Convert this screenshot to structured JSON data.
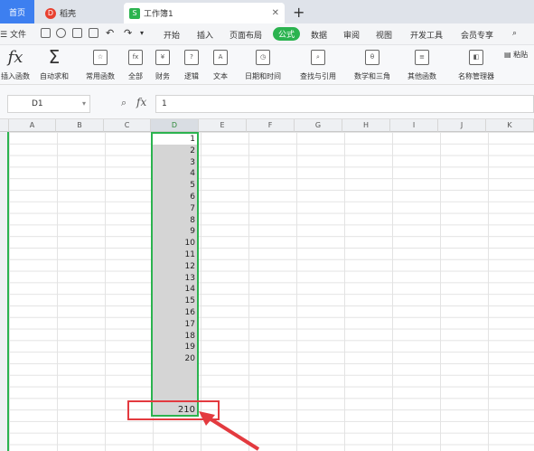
{
  "tabs": {
    "home": "首页",
    "daoke": "稻壳",
    "workbook": "工作簿1"
  },
  "menu": {
    "file": "文件",
    "items": [
      "开始",
      "插入",
      "页面布局",
      "公式",
      "数据",
      "审阅",
      "视图",
      "开发工具",
      "会员专享"
    ],
    "active": "公式"
  },
  "ribbon": {
    "insert_function": "插入函数",
    "autosum": "自动求和",
    "common_functions": "常用函数",
    "all": "全部",
    "financial": "财务",
    "logical": "逻辑",
    "text": "文本",
    "datetime": "日期和时间",
    "lookup": "查找与引用",
    "math": "数学和三角",
    "other": "其他函数",
    "name_manager": "名称管理器",
    "paste": "粘贴"
  },
  "formula_bar": {
    "name_box": "D1",
    "formula": "1"
  },
  "columns": [
    "A",
    "B",
    "C",
    "D",
    "E",
    "F",
    "G",
    "H",
    "I",
    "J",
    "K"
  ],
  "selected_column": "D",
  "cells": [
    "1",
    "2",
    "3",
    "4",
    "5",
    "6",
    "7",
    "8",
    "9",
    "10",
    "11",
    "12",
    "13",
    "14",
    "15",
    "16",
    "17",
    "18",
    "19",
    "20"
  ],
  "total": "210",
  "colors": {
    "accent_green": "#2bb34f",
    "highlight_red": "#e33a3f",
    "home_tab_blue": "#3d7ff0"
  }
}
